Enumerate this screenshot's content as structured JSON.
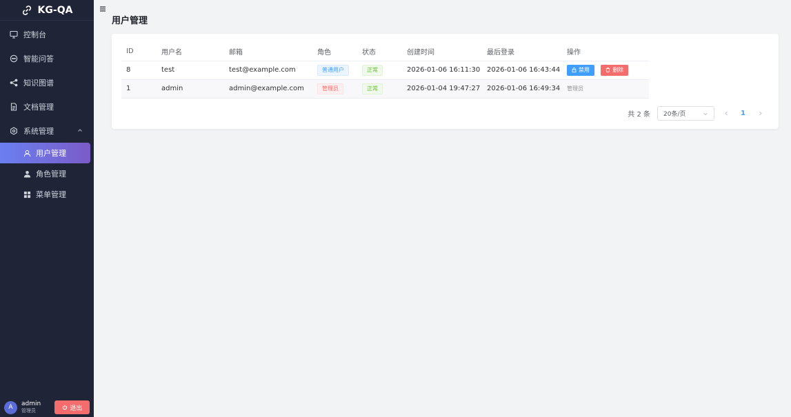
{
  "app": {
    "logo_text": "KG-QA"
  },
  "sidebar": {
    "items": [
      {
        "label": "控制台",
        "icon": "monitor-icon"
      },
      {
        "label": "智能问答",
        "icon": "chat-icon"
      },
      {
        "label": "知识图谱",
        "icon": "share-icon"
      },
      {
        "label": "文档管理",
        "icon": "document-icon"
      }
    ],
    "group": {
      "label": "系统管理",
      "icon": "gear-icon",
      "expanded": true,
      "children": [
        {
          "label": "用户管理",
          "icon": "user-icon",
          "active": true
        },
        {
          "label": "角色管理",
          "icon": "user-filled-icon",
          "active": false
        },
        {
          "label": "菜单管理",
          "icon": "grid-icon",
          "active": false
        }
      ]
    },
    "user": {
      "avatar_letter": "A",
      "name": "admin",
      "role": "管理员",
      "logout_label": "退出"
    }
  },
  "main": {
    "title": "用户管理",
    "table": {
      "headers": {
        "id": "ID",
        "username": "用户名",
        "email": "邮箱",
        "role": "角色",
        "status": "状态",
        "created": "创建时间",
        "last_login": "最后登录",
        "ops": "操作"
      },
      "rows": [
        {
          "id": "8",
          "username": "test",
          "email": "test@example.com",
          "role": "普通用户",
          "status": "正常",
          "created": "2026-01-06 16:11:30",
          "last_login": "2026-01-06 16:43:44",
          "op_disable": "禁用",
          "op_delete": "删除"
        },
        {
          "id": "1",
          "username": "admin",
          "email": "admin@example.com",
          "role": "管理员",
          "status": "正常",
          "created": "2026-01-04 19:47:27",
          "last_login": "2026-01-06 16:49:34",
          "op_text": "管理员"
        }
      ]
    },
    "pagination": {
      "total_text": "共 2 条",
      "page_size": "20条/页",
      "current_page": "1"
    }
  },
  "colors": {
    "sidebar_bg": "#1f2437",
    "primary": "#409eff",
    "danger": "#f56c6c",
    "success": "#67c23a",
    "active_gradient_start": "#6b7ff0",
    "active_gradient_end": "#7a5cc8"
  }
}
